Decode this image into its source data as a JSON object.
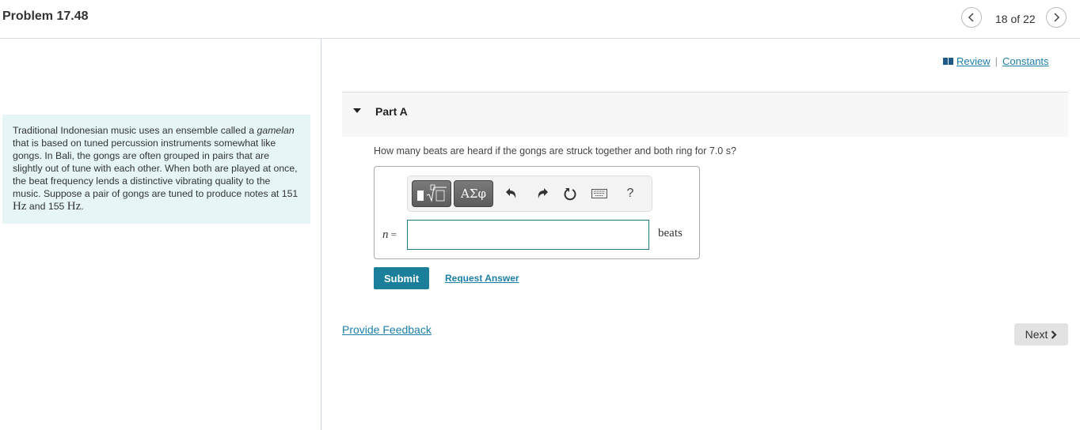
{
  "header": {
    "title": "Problem 17.48",
    "pager": "18 of 22",
    "prev_icon": "chevron-left-icon",
    "next_icon": "chevron-right-icon"
  },
  "problem": {
    "text_before_italic": "Traditional Indonesian music uses an ensemble called a ",
    "italic": "gamelan",
    "text_after_italic": " that is based on tuned percussion instruments somewhat like gongs. In Bali, the gongs are often grouped in pairs that are slightly out of tune with each other. When both are played at once, the beat frequency lends a distinctive vibrating quality to the music. Suppose a pair of gongs are tuned to produce notes at 151 ",
    "unit1": "Hz",
    "mid": " and 155 ",
    "unit2": "Hz",
    "end": "."
  },
  "links": {
    "review": "Review",
    "separator": "|",
    "constants": "Constants"
  },
  "part": {
    "title": "Part A",
    "question": "How many beats are heard if the gongs are struck together and both ring for 7.0 s?",
    "toolbar": {
      "templates_icon": "templates-icon",
      "greek_label": "ΑΣφ",
      "help_label": "?"
    },
    "variable": "n",
    "equals": " =",
    "input_value": "",
    "unit": "beats",
    "submit_label": "Submit",
    "request_label": "Request Answer"
  },
  "footer": {
    "feedback_label": "Provide Feedback",
    "next_label": "Next"
  },
  "colors": {
    "accent": "#1a7f9b",
    "link": "#1d7fa8",
    "problem_bg": "#e6f5f6"
  }
}
